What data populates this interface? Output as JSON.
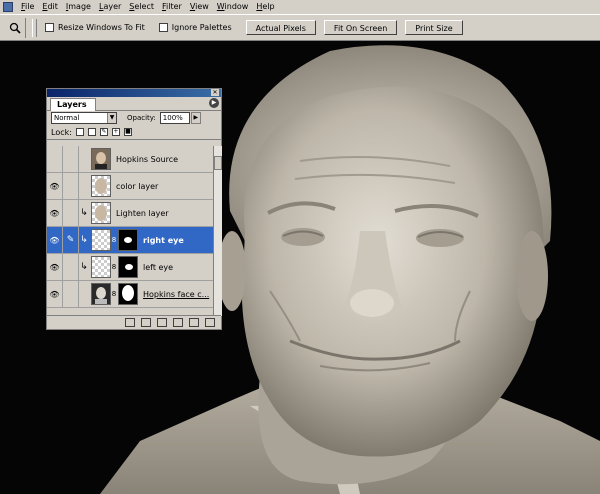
{
  "menubar": {
    "items": [
      "File",
      "Edit",
      "Image",
      "Layer",
      "Select",
      "Filter",
      "View",
      "Window",
      "Help"
    ]
  },
  "options_bar": {
    "tool_icon": "zoom-icon",
    "resize_windows_label": "Resize Windows To Fit",
    "ignore_palettes_label": "Ignore Palettes",
    "actual_pixels_label": "Actual Pixels",
    "fit_on_screen_label": "Fit On Screen",
    "print_size_label": "Print Size"
  },
  "layers_panel": {
    "tab_label": "Layers",
    "blend_mode": "Normal",
    "opacity_label": "Opacity:",
    "opacity_value": "100%",
    "lock_label": "Lock:",
    "layers": [
      {
        "name": "Hopkins Source",
        "visible": false,
        "selected": false
      },
      {
        "name": "color layer",
        "visible": true,
        "selected": false
      },
      {
        "name": "Lighten layer",
        "visible": true,
        "selected": false
      },
      {
        "name": "right eye",
        "visible": true,
        "selected": true
      },
      {
        "name": "left eye",
        "visible": true,
        "selected": false
      },
      {
        "name": "Hopkins face c...",
        "visible": true,
        "selected": false
      }
    ],
    "selection_color": "#3168c5"
  }
}
